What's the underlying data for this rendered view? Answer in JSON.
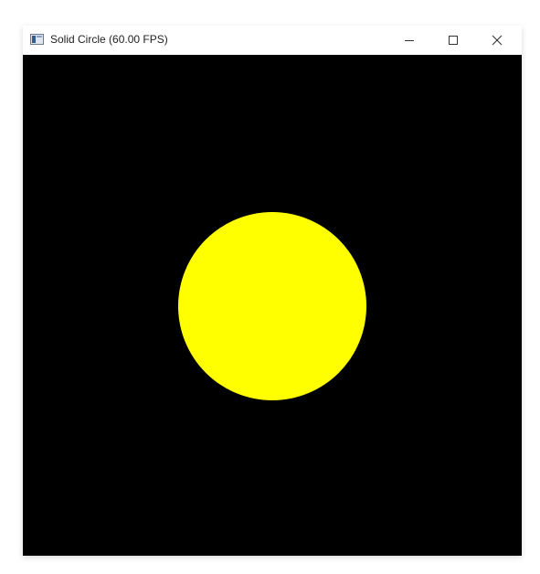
{
  "window": {
    "title": "Solid Circle (60.00 FPS)",
    "controls": {
      "minimize_icon": "minimize-icon",
      "maximize_icon": "maximize-icon",
      "close_icon": "close-icon"
    }
  },
  "canvas": {
    "background_color": "#000000",
    "circle_color": "#ffff00"
  }
}
